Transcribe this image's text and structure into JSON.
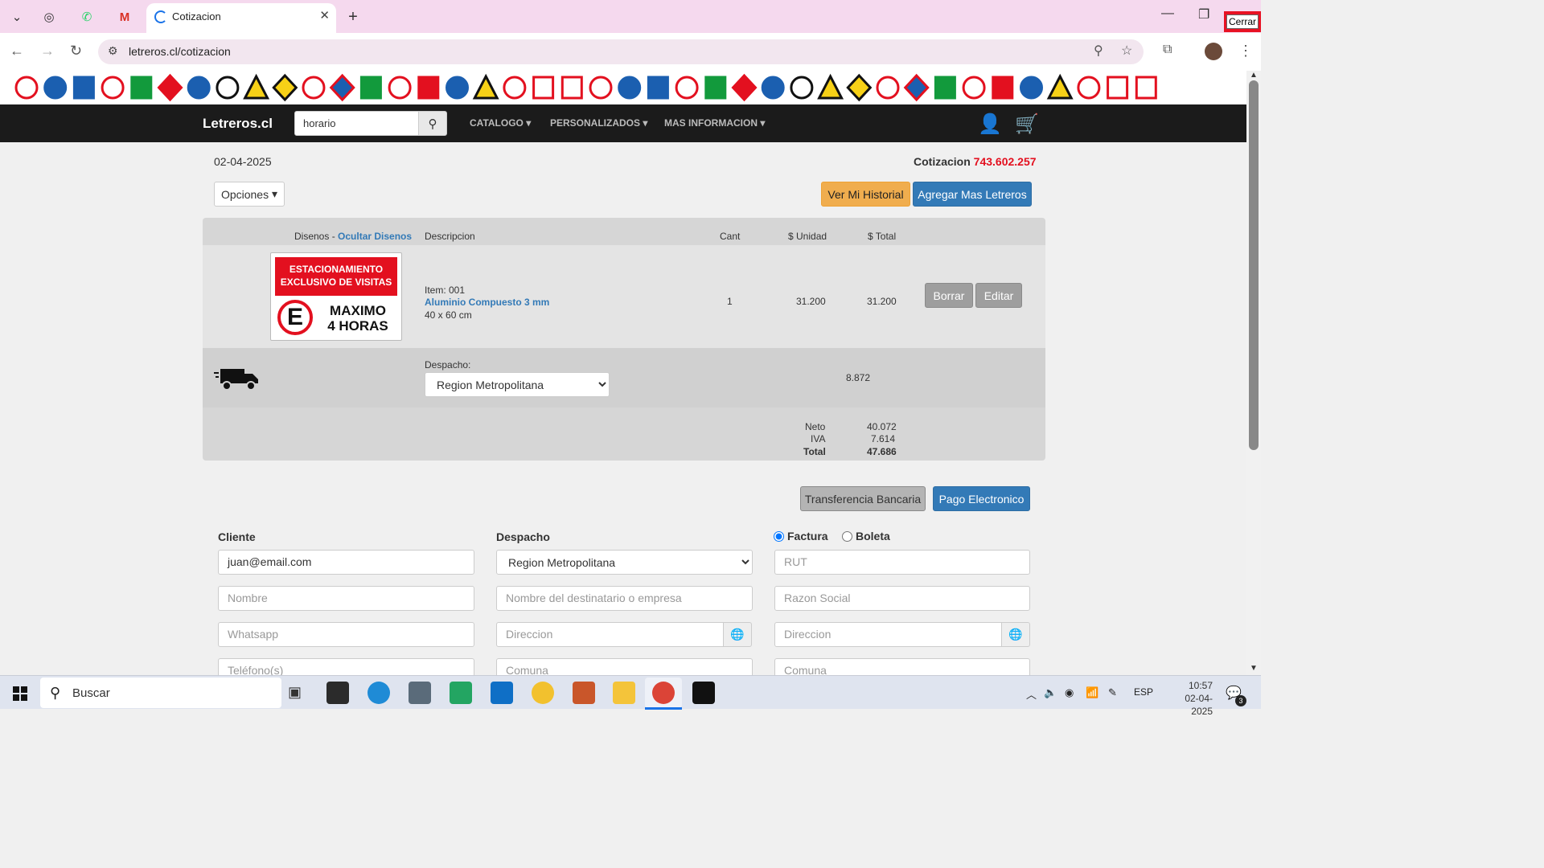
{
  "browser": {
    "tab_title": "Cotizacion",
    "url": "letreros.cl/cotizacion",
    "close_tooltip": "Cerrar"
  },
  "site": {
    "brand": "Letreros.cl",
    "search_value": "horario",
    "menu": [
      "CATALOGO",
      "PERSONALIZADOS",
      "MAS INFORMACION"
    ]
  },
  "quote": {
    "date": "02-04-2025",
    "label": "Cotizacion",
    "number": "743.602.257",
    "options_label": "Opciones",
    "history_button": "Ver Mi Historial",
    "add_button": "Agregar Mas Letreros"
  },
  "table": {
    "headers": {
      "designs": "Disenos -",
      "hide_designs": "Ocultar Disenos",
      "description": "Descripcion",
      "qty": "Cant",
      "unit": "$ Unidad",
      "total": "$ Total"
    },
    "item": {
      "number": "Item: 001",
      "material": "Aluminio Compuesto 3 mm",
      "size": "40 x 60 cm",
      "qty": "1",
      "unit_price": "31.200",
      "total": "31.200",
      "delete_label": "Borrar",
      "edit_label": "Editar",
      "sign_top_line1": "ESTACIONAMIENTO",
      "sign_top_line2": "EXCLUSIVO DE VISITAS",
      "sign_letter": "E",
      "sign_bottom_line1": "MAXIMO",
      "sign_bottom_line2": "4 HORAS"
    },
    "shipping": {
      "label": "Despacho:",
      "region": "Region Metropolitana",
      "cost": "8.872"
    },
    "totals": {
      "neto_label": "Neto",
      "neto": "40.072",
      "iva_label": "IVA",
      "iva": "7.614",
      "total_label": "Total",
      "total": "47.686"
    }
  },
  "payment": {
    "transfer": "Transferencia Bancaria",
    "electronic": "Pago Electronico"
  },
  "form": {
    "cliente_label": "Cliente",
    "email": "juan@email.com",
    "nombre_ph": "Nombre",
    "whatsapp_ph": "Whatsapp",
    "telefono_ph": "Teléfono(s)",
    "despacho_label": "Despacho",
    "despacho_region": "Region Metropolitana",
    "destinatario_ph": "Nombre del destinatario o empresa",
    "direccion_ph": "Direccion",
    "comuna_ph": "Comuna",
    "factura_label": "Factura",
    "boleta_label": "Boleta",
    "rut_ph": "RUT",
    "razon_ph": "Razon Social"
  },
  "taskbar": {
    "search": "Buscar",
    "lang": "ESP",
    "time": "10:57",
    "date": "02-04-2025",
    "notif_count": "3"
  },
  "colors": {
    "tabbar": "#f5d9ee",
    "navbar": "#1b1b1b",
    "link": "#337ab7",
    "quote_number": "#e3101f",
    "orange_btn": "#f0ad4e",
    "blue_btn": "#337ab7"
  }
}
